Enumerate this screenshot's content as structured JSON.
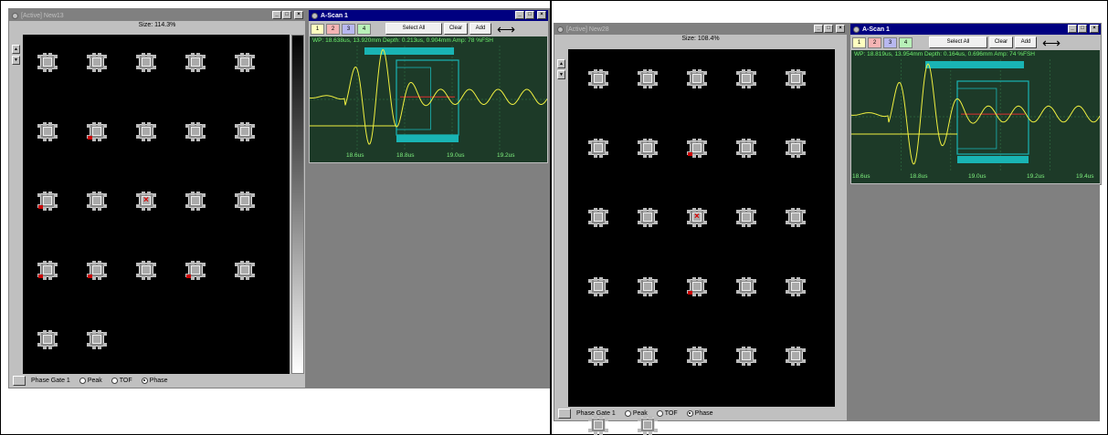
{
  "left": {
    "main_window": {
      "title": "[Active] New13",
      "size_label": "Size: 114.3%",
      "status": {
        "gate_label": "Phase Gate 1",
        "options": [
          "Peak",
          "TOF",
          "Phase"
        ],
        "selected": "Phase"
      }
    },
    "ascan": {
      "title": "A-Scan 1",
      "gate_buttons": [
        "1",
        "2",
        "3",
        "4"
      ],
      "select_all": "Select All",
      "clear": "Clear",
      "add": "Add",
      "arrow": "⟷",
      "readout": "WP: 18.638us, 13.920mm  Depth: 0.213us, 0.904mm  Amp:  78 %FSH",
      "ticks": [
        "18.6us",
        "18.8us",
        "19.0us",
        "19.2us"
      ]
    }
  },
  "right": {
    "main_window": {
      "title": "[Active] New28",
      "size_label": "Size: 108.4%",
      "status": {
        "gate_label": "Phase Gate 1",
        "options": [
          "Peak",
          "TOF",
          "Phase"
        ],
        "selected": "Phase"
      }
    },
    "ascan": {
      "title": "A-Scan 1",
      "gate_buttons": [
        "1",
        "2",
        "3",
        "4"
      ],
      "select_all": "Select All",
      "clear": "Clear",
      "add": "Add",
      "arrow": "⟷",
      "readout": "WP: 18.819us, 13.954mm  Depth: 0.164us, 0.696mm  Amp:  74 %FSH",
      "ticks": [
        "18.6us",
        "18.8us",
        "19.0us",
        "19.2us",
        "19.4us"
      ]
    }
  },
  "colors": {
    "scope_bg": "#1d3a28",
    "trace": "#f0f040",
    "gate": "#19b4b4",
    "title_active": "#000080"
  }
}
